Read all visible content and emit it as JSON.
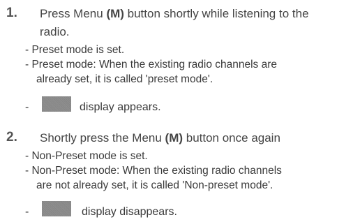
{
  "steps": [
    {
      "number": "1.",
      "text_before": "Press Menu ",
      "key_label": "(M)",
      "text_after": " button shortly while listening to the",
      "text_line2": "radio.",
      "sub_items": [
        {
          "line1": "- Preset mode is set.",
          "line2": ""
        },
        {
          "line1": "- Preset mode: When the existing radio channels are",
          "line2": "already set, it is called 'preset mode'."
        }
      ],
      "display_dash": "-",
      "display_text": "display appears."
    },
    {
      "number": "2.",
      "text_before": "Shortly press the Menu ",
      "key_label": "(M)",
      "text_after": " button once again",
      "text_line2": "",
      "sub_items": [
        {
          "line1": "- Non-Preset mode is set.",
          "line2": ""
        },
        {
          "line1": "- Non-Preset mode: When the existing radio channels",
          "line2": "are not already set, it is called 'Non-preset mode'."
        }
      ],
      "display_dash": "-",
      "display_text": "display disappears."
    }
  ]
}
